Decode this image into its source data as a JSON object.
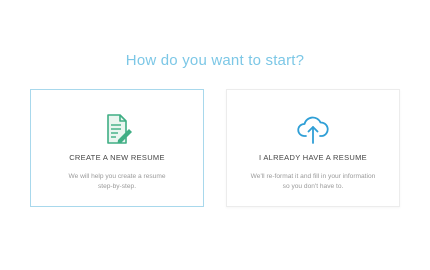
{
  "heading": "How do you want to start?",
  "options": [
    {
      "title": "CREATE A NEW RESUME",
      "description_line1": "We will help you create a resume",
      "description_line2": "step-by-step.",
      "icon": "document-edit-icon",
      "icon_color": "#3fae84"
    },
    {
      "title": "I ALREADY HAVE A RESUME",
      "description_line1": "We'll re-format it and fill in your information",
      "description_line2": "so you don't have to.",
      "icon": "cloud-upload-icon",
      "icon_color": "#2f9fd6"
    }
  ],
  "colors": {
    "heading": "#7cc7e6",
    "selected_border": "#a8d8ec",
    "card_border": "#ececec"
  }
}
